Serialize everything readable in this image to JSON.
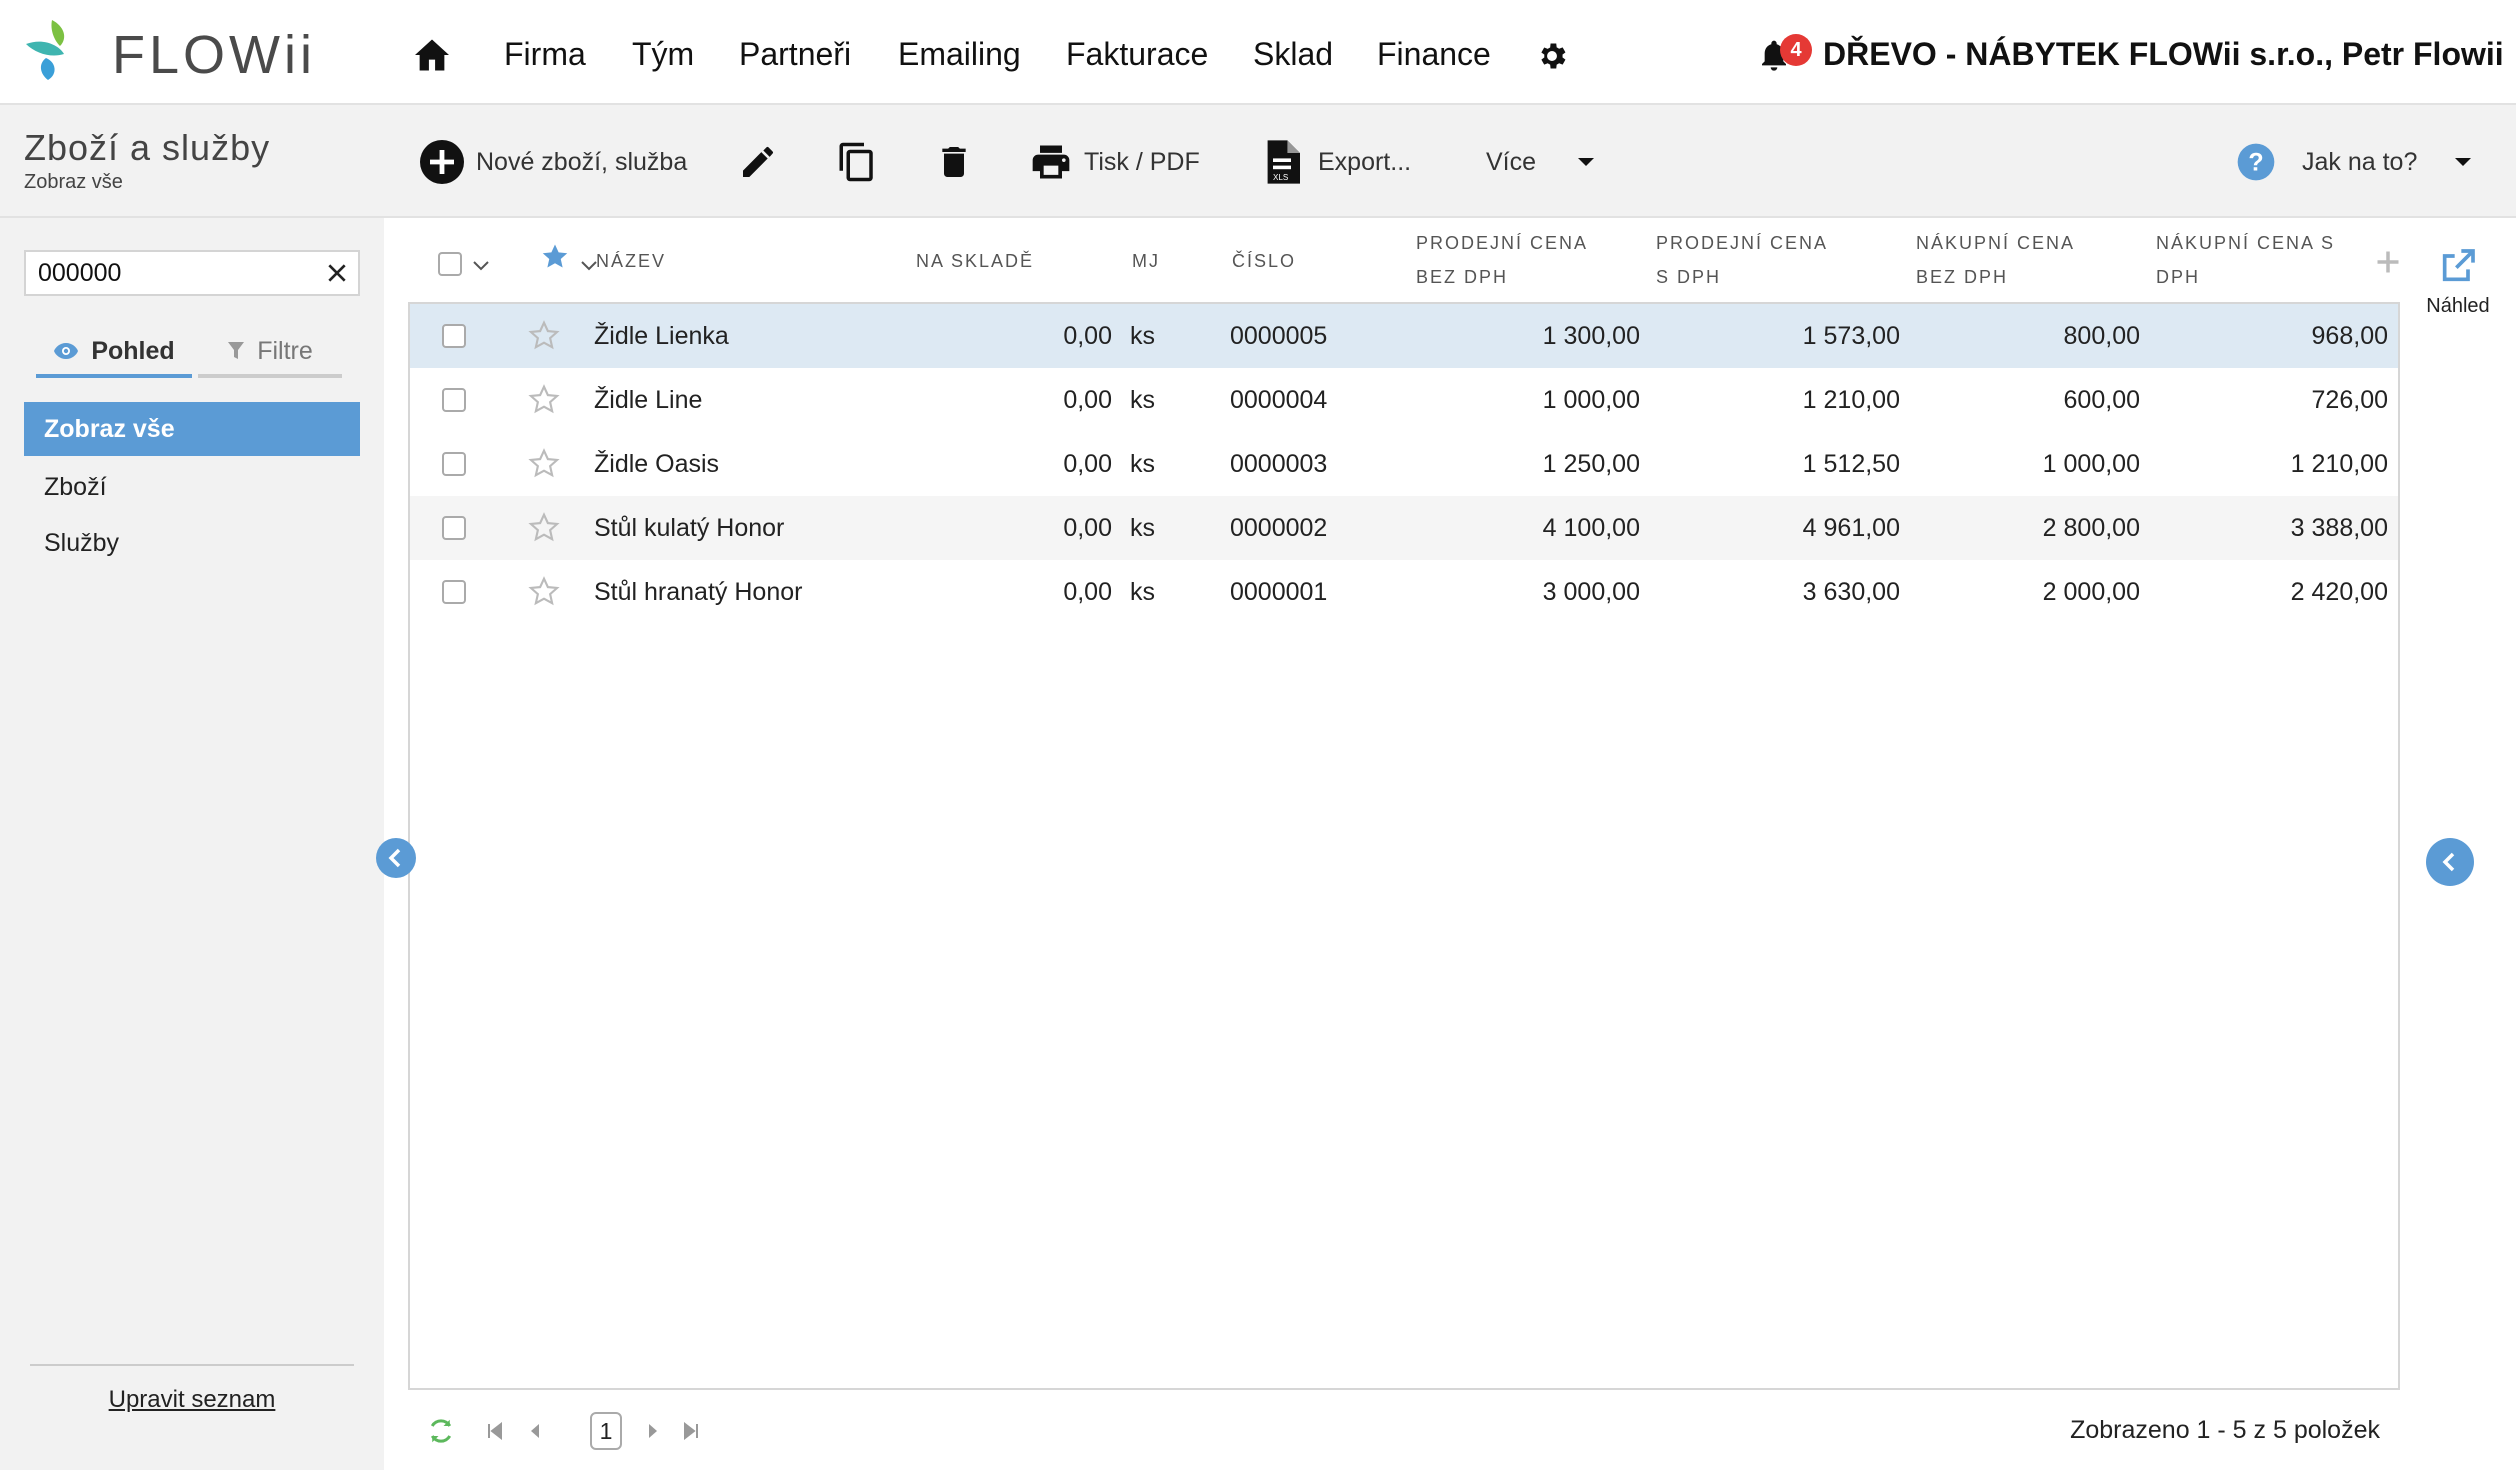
{
  "app": {
    "logo_text": "FLOWii"
  },
  "nav": {
    "items": [
      "Firma",
      "Tým",
      "Partneři",
      "Emailing",
      "Fakturace",
      "Sklad",
      "Finance"
    ],
    "notification_count": "4",
    "company_user": "DŘEVO - NÁBYTEK FLOWii s.r.o., Petr Flowii"
  },
  "toolbar": {
    "title": "Zboží a služby",
    "subtitle": "Zobraz vše",
    "new_label": "Nové zboží, služba",
    "print_label": "Tisk / PDF",
    "export_label": "Export...",
    "more_label": "Více",
    "help_label": "Jak na to?"
  },
  "sidebar": {
    "search_value": "000000",
    "tab_view": "Pohled",
    "tab_filter": "Filtre",
    "items": [
      "Zobraz vše",
      "Zboží",
      "Služby"
    ],
    "edit_list": "Upravit seznam"
  },
  "grid": {
    "columns": {
      "name": "NÁZEV",
      "stock": "NA SKLADĚ",
      "unit": "MJ",
      "number": "ČÍSLO",
      "sale_net_1": "PRODEJNÍ CENA",
      "sale_net_2": "BEZ DPH",
      "sale_gross_1": "PRODEJNÍ CENA",
      "sale_gross_2": "S DPH",
      "buy_net_1": "NÁKUPNÍ CENA",
      "buy_net_2": "BEZ DPH",
      "buy_gross_1": "NÁKUPNÍ CENA S",
      "buy_gross_2": "DPH"
    },
    "rows": [
      {
        "name": "Židle Lienka",
        "stock": "0,00",
        "unit": "ks",
        "number": "0000005",
        "sale_net": "1 300,00",
        "sale_gross": "1 573,00",
        "buy_net": "800,00",
        "buy_gross": "968,00"
      },
      {
        "name": "Židle Line",
        "stock": "0,00",
        "unit": "ks",
        "number": "0000004",
        "sale_net": "1 000,00",
        "sale_gross": "1 210,00",
        "buy_net": "600,00",
        "buy_gross": "726,00"
      },
      {
        "name": "Židle Oasis",
        "stock": "0,00",
        "unit": "ks",
        "number": "0000003",
        "sale_net": "1 250,00",
        "sale_gross": "1 512,50",
        "buy_net": "1 000,00",
        "buy_gross": "1 210,00"
      },
      {
        "name": "Stůl kulatý Honor",
        "stock": "0,00",
        "unit": "ks",
        "number": "0000002",
        "sale_net": "4 100,00",
        "sale_gross": "4 961,00",
        "buy_net": "2 800,00",
        "buy_gross": "3 388,00"
      },
      {
        "name": "Stůl hranatý Honor",
        "stock": "0,00",
        "unit": "ks",
        "number": "0000001",
        "sale_net": "3 000,00",
        "sale_gross": "3 630,00",
        "buy_net": "2 000,00",
        "buy_gross": "2 420,00"
      }
    ]
  },
  "pager": {
    "page": "1",
    "status": "Zobrazeno 1 - 5 z 5 položek"
  },
  "rail": {
    "preview_label": "Náhled"
  },
  "colors": {
    "accent": "#5b9bd5",
    "badge": "#e53935",
    "selected_row": "#dde9f3"
  },
  "icons": [
    "home-icon",
    "gear-icon",
    "bell-icon",
    "plus-circle-icon",
    "pencil-icon",
    "copy-icon",
    "trash-icon",
    "printer-icon",
    "xls-file-icon",
    "caret-down-icon",
    "help-icon",
    "eye-icon",
    "funnel-icon",
    "star-icon",
    "refresh-icon",
    "external-link-icon",
    "chevron-left-icon"
  ]
}
